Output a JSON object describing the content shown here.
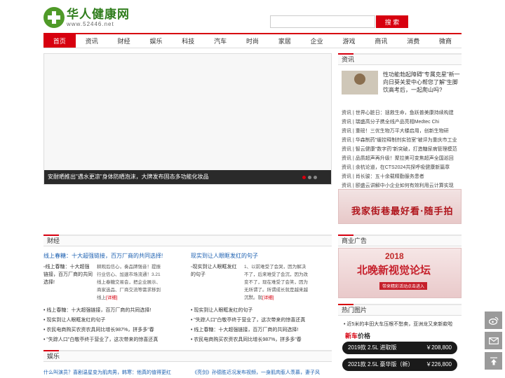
{
  "header": {
    "logo_cn": "华人健康网",
    "logo_url": "www.52446.net",
    "search_button": "搜 索"
  },
  "nav": [
    {
      "label": "首页",
      "active": true
    },
    {
      "label": "资讯"
    },
    {
      "label": "财经"
    },
    {
      "label": "娱乐"
    },
    {
      "label": "科技"
    },
    {
      "label": "汽车"
    },
    {
      "label": "时尚"
    },
    {
      "label": "家居"
    },
    {
      "label": "企业"
    },
    {
      "label": "游戏"
    },
    {
      "label": "商讯"
    },
    {
      "label": "消费"
    },
    {
      "label": "微商"
    }
  ],
  "slider": {
    "caption": "安耐晒推出\"遇水更凉\"身体防晒泡沫，大牌发布固态多功能化妆品"
  },
  "news": {
    "head": "资讯",
    "feature": "性功能勃起障碍\"专属克星\"新一向日葵关爱中心帮您了解\"生脚饮高考后，一起爬山吗?",
    "items": [
      "资讯 | 世界心脏日：拯救生命，鱼跃普美康持续构建",
      "资讯 | 瑞盛高分子携全线产品亮相Medtec Chi",
      "资讯 | 重磅！三优生物万平大楼启用，创新生物研",
      "资讯 | 华森制药\"缓控释制剂实验室\"被评为重庆市工业",
      "资讯 | 智云健康\"数字药\"新突破，打造糖尿病管理模范",
      "资讯 | 品质超声再升级！聚拉美可变焦超声全国巡回",
      "资讯 | 余杭论道，在CTS2024共探呼吸健康新篇章",
      "资讯 | 肖长骏：五十余载精勤服务患者",
      "资讯 | 颐盛云讲解中小企业如何有效利用云计算实现"
    ]
  },
  "banner1": {
    "text": "我家街巷最好看·随手拍"
  },
  "ad": {
    "head": "商业广告",
    "year": "2018",
    "text": "北晚新视觉论坛",
    "sub": "带来精彩活动点击进入"
  },
  "hot": {
    "head": "热门图片",
    "item": "近5米的丰田大车压根不愁卖，亚洲龙又来新款啦",
    "price_title_hl": "新车",
    "price_title_rest": "价格",
    "prices": [
      {
        "model": "2019款 2.5L 进取版",
        "price": "￥208,800"
      },
      {
        "model": "2021款 2.5L 豪华版（新）",
        "price": "￥226,800"
      }
    ]
  },
  "caijing": {
    "head": "财经",
    "left": {
      "title": "线上春糖：十大超强链接，百万厂商的共同选择!",
      "img_alt": "线上春糖：十大超强链接，百万厂商的共同选择!",
      "desc": "耕观后信心，奏品牌强音！提振行业信心、加速市场流通！3.21线上春糖交易会，把企业展示、商家选品、厂商交流等需求移到线上",
      "more": "[详细]"
    },
    "right": {
      "title": "现实到让人眼眶发红的句子",
      "img_alt": "现实到让人眼眶发红的句子",
      "desc": "1、以前难受了会哭，因为解决不了，后来难受了会沉，因为改变不了，现在难受了会笑，因为无所谓了。所谓成长就是越来越沉默。就",
      "more": "[详细]"
    },
    "list_left": [
      "• 线上春糖：十大超强链接，百万厂商的共同选择!",
      "• 现实到让人眼眶发红的句子",
      "• 农民电商购买农资农具同比增长987%，拼多多\"春",
      "• \"失踪人口\"白敬亭终于营业了，这次带来的惊喜还真"
    ],
    "list_right": [
      "• 现实到让人眼眶发红的句子",
      "• \"失踪人口\"白敬亭终于营业了，这次带来的惊喜还真",
      "• 线上春糖：十大超强链接，百万厂商的共同选择!",
      "• 农民电商购买农资农具同比增长987%，拼多多\"春"
    ]
  },
  "yule": {
    "head": "娱乐",
    "left": "什么叫演员？喜剧温星变为肌肉男，韩寒：他真的值得更红",
    "right": "《亮剑》孙德胜近况发布视频，一身肌肉惹人羡慕，妻子风"
  }
}
